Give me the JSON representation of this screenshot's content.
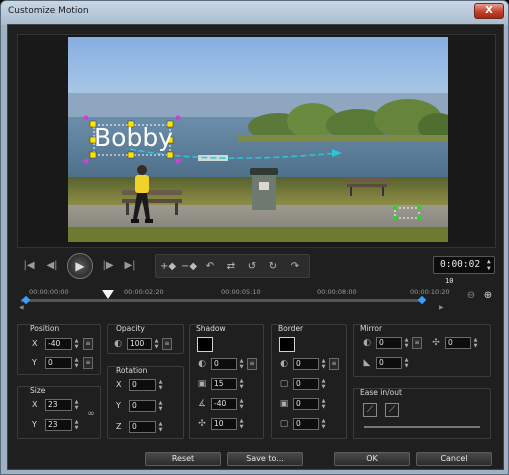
{
  "window": {
    "title": "Customize Motion",
    "close_label": "X"
  },
  "preview": {
    "title_text": "Bobby"
  },
  "timecode": {
    "value": "0:00:02",
    "frames": "10"
  },
  "ruler": {
    "ticks": [
      "00:00:00:00",
      "00:00:02:20",
      "00:00:05:10",
      "00:00:08:00",
      "00:00:10:20"
    ]
  },
  "position": {
    "label": "Position",
    "x_label": "X",
    "x_value": "-40",
    "y_label": "Y",
    "y_value": "0"
  },
  "size": {
    "label": "Size",
    "x_label": "X",
    "x_value": "23",
    "y_label": "Y",
    "y_value": "23"
  },
  "opacity": {
    "label": "Opacity",
    "value": "100"
  },
  "rotation": {
    "label": "Rotation",
    "x_label": "X",
    "x_value": "0",
    "y_label": "Y",
    "y_value": "0",
    "z_label": "Z",
    "z_value": "0"
  },
  "shadow": {
    "label": "Shadow",
    "color": "#000000",
    "opacity": "0",
    "blur": "15",
    "angle": "-40",
    "distance": "10"
  },
  "border": {
    "label": "Border",
    "color": "#000000",
    "opacity": "0",
    "width": "0",
    "v2": "0",
    "v3": "0"
  },
  "mirror": {
    "label": "Mirror",
    "opacity": "0",
    "distance": "0",
    "v3": "0"
  },
  "ease": {
    "label": "Ease in/out"
  },
  "footer": {
    "reset": "Reset",
    "save_to": "Save to...",
    "ok": "OK",
    "cancel": "Cancel"
  }
}
